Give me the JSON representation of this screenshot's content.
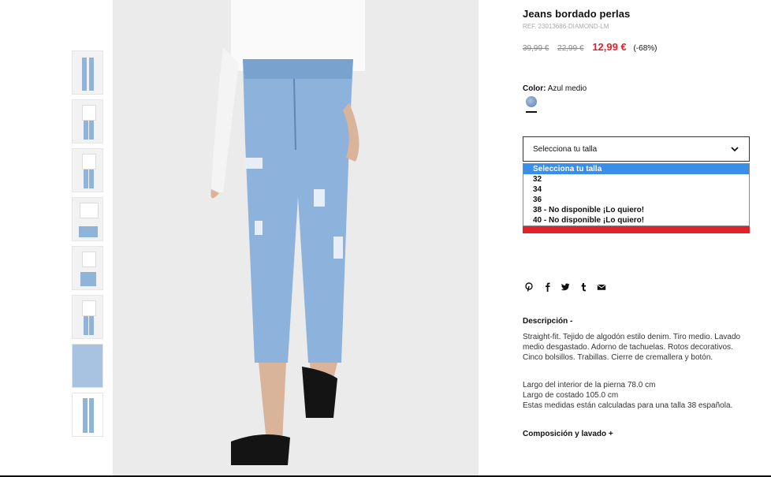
{
  "product": {
    "title": "Jeans bordado perlas",
    "ref": "REF. 23013686-DIAMOND-LM",
    "price_original": "39,99 €",
    "price_previous": "22,99 €",
    "price_now": "12,99 €",
    "discount": "(-68%)"
  },
  "color": {
    "label": "Color:",
    "value": "Azul medio"
  },
  "size": {
    "placeholder": "Selecciona tu talla",
    "options": [
      "Selecciona tu talla",
      "32",
      "34",
      "36",
      "38 - No disponible ¡Lo quiero!",
      "40 - No disponible ¡Lo quiero!"
    ]
  },
  "share": [
    "pinterest-icon",
    "facebook-icon",
    "twitter-icon",
    "tumblr-icon",
    "mail-icon"
  ],
  "description": {
    "heading": "Descripción -",
    "text": "Straight-fit. Tejido de algodón estilo denim. Tiro medio. Lavado medio desgastado. Adorno de tachuelas. Rotos decorativos. Cinco bolsillos. Trabillas. Cierre de cremallera y botón.",
    "measures": [
      "Largo del interior de la pierna 78.0 cm",
      "Largo de costado 105.0 cm",
      "Estas medidas están calculadas para una talla 38 española."
    ]
  },
  "composition_heading": "Composición y lavado +",
  "colors": {
    "sale": "#e2222a",
    "highlight": "#3b8ee8"
  }
}
